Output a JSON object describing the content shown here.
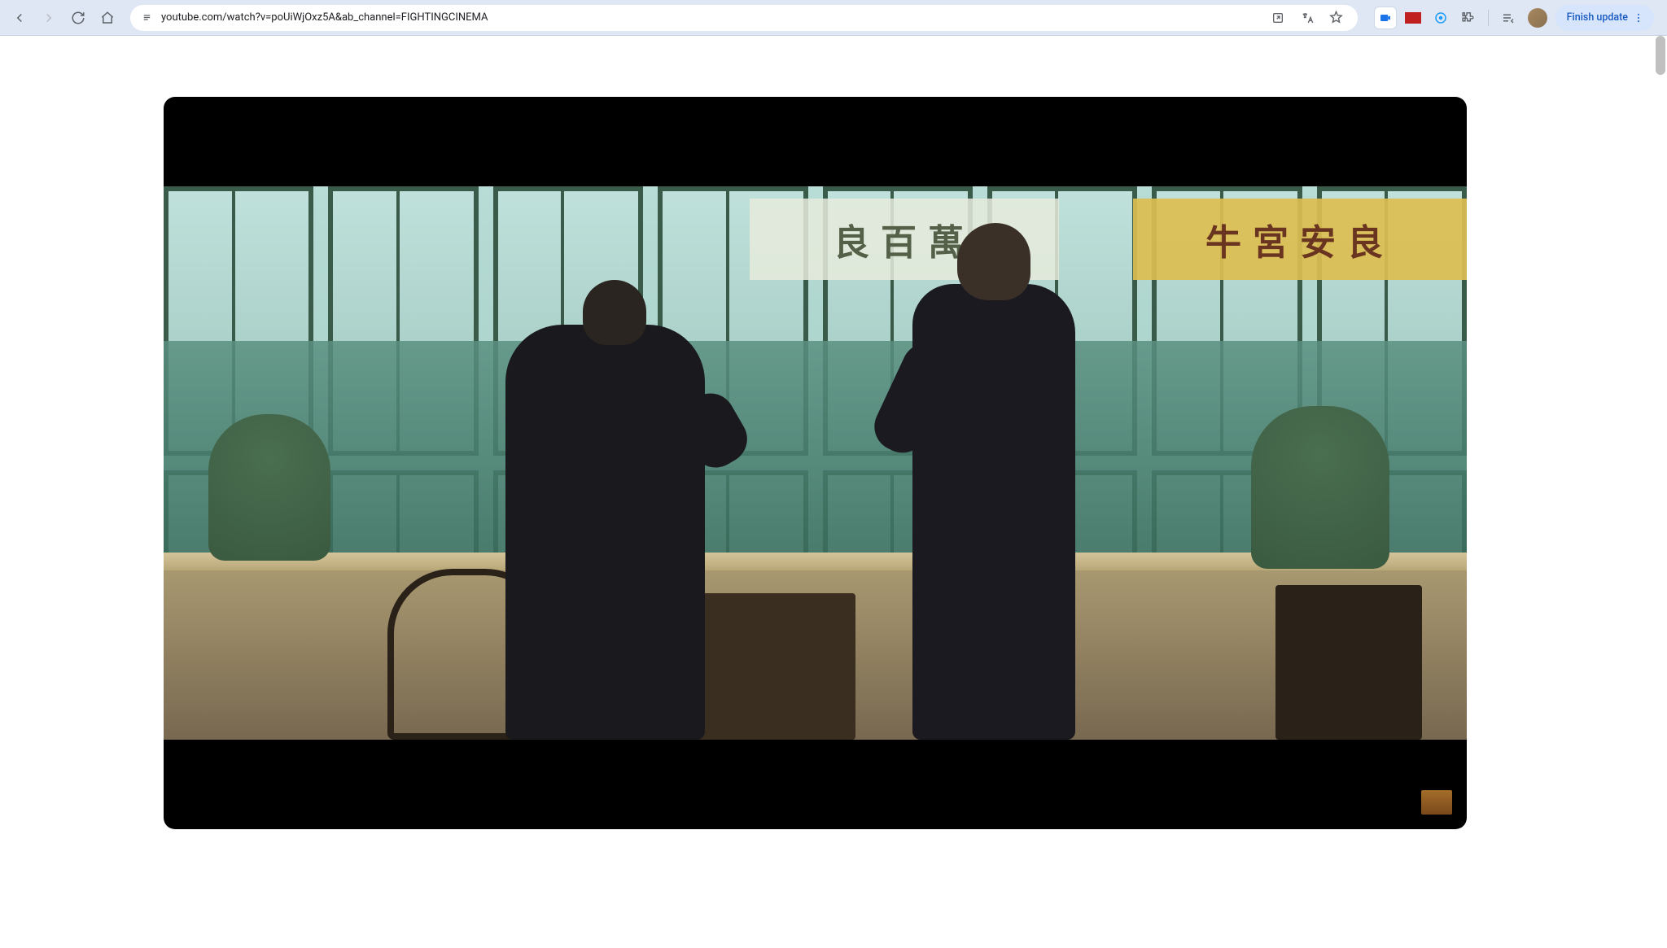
{
  "browser": {
    "url": "youtube.com/watch?v=poUiWjOxz5A&ab_channel=FIGHTINGCINEMA",
    "finish_update_label": "Finish update"
  },
  "video": {
    "billboard_left_text": "良百萬",
    "billboard_right_text": "牛宮安良"
  }
}
